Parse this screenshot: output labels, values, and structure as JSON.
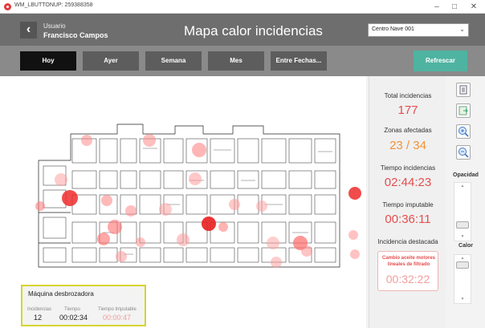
{
  "window": {
    "title": "WM_LBUTTONUP: 259388358",
    "minimize": "–",
    "maximize": "□",
    "close": "✕"
  },
  "header": {
    "back_icon": "‹",
    "user_label": "Usuario",
    "user_name": "Francisco Campos",
    "title": "Mapa calor incidencias",
    "center_select": "Centro Nave 001",
    "chevron": "⌄"
  },
  "toolbar": {
    "buttons": [
      "Hoy",
      "Ayer",
      "Semana",
      "Mes",
      "Entre Fechas..."
    ],
    "active": "Hoy",
    "refresh": "Refrescar"
  },
  "stats": {
    "total_label": "Total incidencias",
    "total_value": "177",
    "zones_label": "Zonas afectadas",
    "zones_value": "23 / 34",
    "time_label": "Tiempo incidencias",
    "time_value": "02:44:23",
    "imputable_label": "Tiempo imputable",
    "imputable_value": "00:36:11",
    "highlight_label": "Incidencia destacada",
    "highlight_text": "Cambio aceite motores lineales de filtrado",
    "highlight_time": "00:32:22"
  },
  "tools": {
    "opacity_label": "Opacidad",
    "heat_label": "Calor",
    "icons": [
      "list-icon",
      "export-icon",
      "zoom-in-icon",
      "zoom-out-icon"
    ]
  },
  "machine": {
    "name": "Máquina desbrozadora",
    "incidences_label": "Incidencias",
    "incidences_value": "12",
    "time_label": "Tiempo",
    "time_value": "00:02:34",
    "imputable_label": "Tiempo Imputable",
    "imputable_value": "00:00:47"
  },
  "colors": {
    "header": "#6e6e6e",
    "toolbar": "#8a8a8a",
    "active_button": "#111111",
    "refresh": "#4fb3a1",
    "red": "#e64d4d",
    "orange": "#f0933a",
    "highlight_border": "#d5d52f"
  }
}
